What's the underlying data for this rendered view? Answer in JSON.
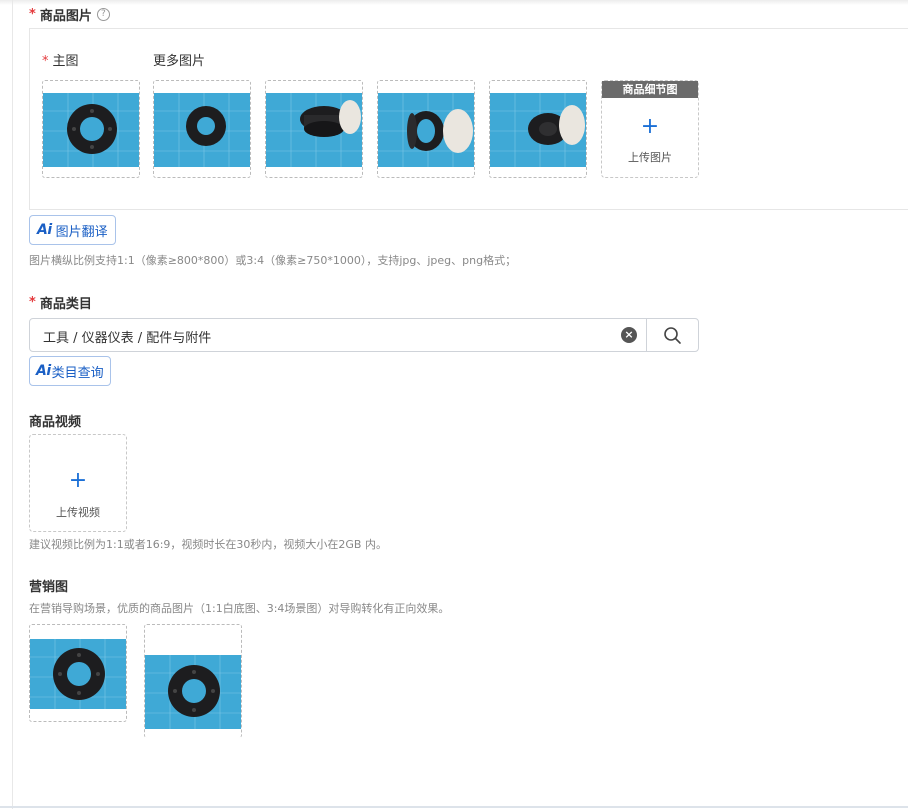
{
  "images_section": {
    "title": "商品图片",
    "help_icon": "question-circle-icon",
    "main_label": "主图",
    "more_label": "更多图片",
    "detail_tag": "商品细节图",
    "upload_label": "上传图片",
    "ai_translate_label": "图片翻译",
    "hint": "图片横纵比例支持1:1（像素≥800*800）或3:4（像素≥750*1000），支持jpg、jpeg、png格式；"
  },
  "category_section": {
    "title": "商品类目",
    "value": "工具 / 仪器仪表 / 配件与附件",
    "clear_icon": "clear-circle-icon",
    "search_icon": "search-icon",
    "ai_query_label": "类目查询"
  },
  "video_section": {
    "title": "商品视频",
    "upload_label": "上传视频",
    "hint": "建议视频比例为1:1或者16:9，视频时长在30秒内，视频大小在2GB 内。"
  },
  "marketing_section": {
    "title": "营销图",
    "hint": "在营销导购场景，优质的商品图片（1:1白底图、3:4场景图）对导购转化有正向效果。"
  },
  "ai_mark": "Ai",
  "colors": {
    "accent": "#1a6fd6",
    "required": "#e4393c",
    "mat": "#3fa9d6"
  }
}
